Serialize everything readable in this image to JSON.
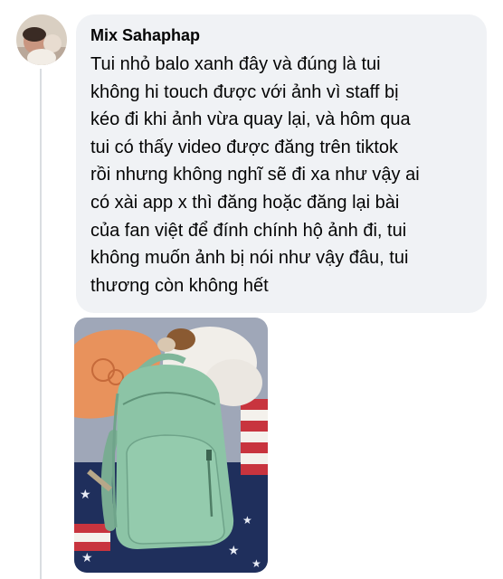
{
  "comment": {
    "author": "Mix Sahaphap",
    "text_lines": [
      "Tui nhỏ balo xanh đây và đúng là tui",
      "không hi touch được với ảnh vì staff bị",
      "kéo đi khi ảnh vừa quay lại, và hôm qua",
      "tui có thấy video được đăng trên tiktok",
      "rồi nhưng không nghĩ sẽ đi xa như vậy ai",
      "có xài app x thì đăng hoặc đăng lại bài",
      "của fan việt để đính chính hộ ảnh đi, tui",
      "không muốn ảnh bị nói như vậy đâu, tui",
      "thương còn không hết"
    ]
  },
  "colors": {
    "bubble_bg": "#f0f2f5",
    "text": "#050505",
    "backpack": "#8cc4a6"
  }
}
